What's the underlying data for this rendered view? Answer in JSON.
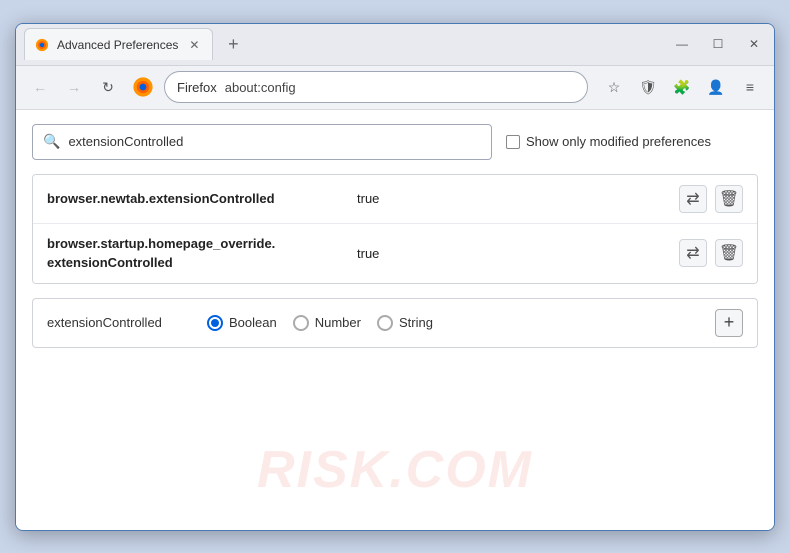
{
  "window": {
    "title": "Advanced Preferences",
    "new_tab_icon": "+",
    "controls": {
      "minimize": "—",
      "maximize": "☐",
      "close": "✕"
    }
  },
  "navbar": {
    "back_icon": "←",
    "forward_icon": "→",
    "refresh_icon": "↻",
    "browser_name": "Firefox",
    "address": "about:config",
    "bookmark_icon": "☆",
    "shield_icon": "🛡",
    "extension_icon": "🧩",
    "profile_icon": "👤",
    "menu_icon": "≡"
  },
  "search": {
    "placeholder": "extensionControlled",
    "value": "extensionControlled",
    "show_modified_label": "Show only modified preferences"
  },
  "preferences": [
    {
      "name": "browser.newtab.extensionControlled",
      "value": "true",
      "multiline": false
    },
    {
      "name_line1": "browser.startup.homepage_override.",
      "name_line2": "extensionControlled",
      "value": "true",
      "multiline": true
    }
  ],
  "add_preference": {
    "name": "extensionControlled",
    "types": [
      {
        "label": "Boolean",
        "selected": true
      },
      {
        "label": "Number",
        "selected": false
      },
      {
        "label": "String",
        "selected": false
      }
    ],
    "add_btn_label": "+"
  },
  "watermark": "RISK.COM",
  "colors": {
    "accent": "#0060df",
    "border": "#4a7ab5"
  }
}
